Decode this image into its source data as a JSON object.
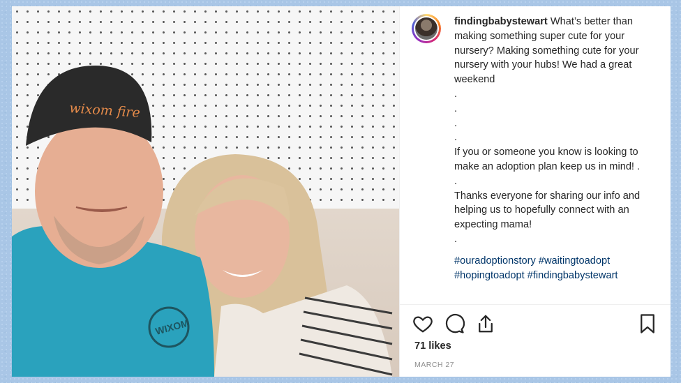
{
  "post": {
    "username": "findingbabystewart",
    "caption_lines": [
      "What’s better than making something super cute for your nursery? Making something cute for your nursery with your hubs! We had a great weekend",
      ".",
      ".",
      ".",
      ".",
      "If you or someone you know is looking to make an adoption plan keep us in mind! .",
      ".",
      "Thanks everyone for sharing our info and helping us to hopefully connect with an expecting mama!",
      "."
    ],
    "hashtags": "#ouradoptionstory #waitingtoadopt #hopingtoadopt #findingbabystewart",
    "likes": "71 likes",
    "date": "MARCH 27",
    "hat_text": "wixom fire",
    "shirt_text": "WIXOM"
  },
  "icons": {
    "like": "heart-icon",
    "comment": "comment-icon",
    "share": "share-icon",
    "save": "bookmark-icon"
  }
}
